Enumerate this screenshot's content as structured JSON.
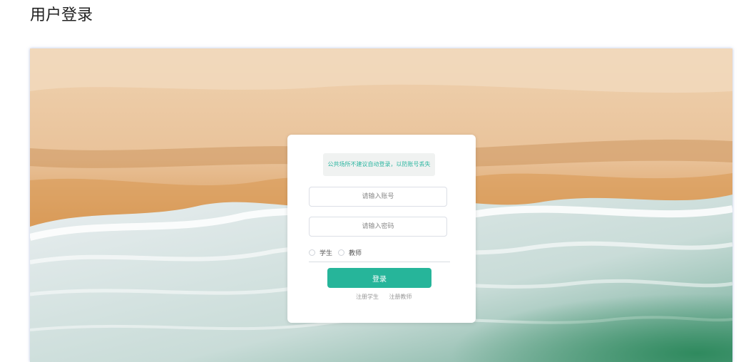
{
  "page": {
    "title": "用户登录"
  },
  "login": {
    "notice": "公共场所不建议自动登录，以防账号丢失",
    "account_placeholder": "请输入账号",
    "password_placeholder": "请输入密码",
    "roles": [
      "学生",
      "教师"
    ],
    "submit_label": "登录",
    "links": [
      "注册学生",
      "注册教师"
    ]
  },
  "colors": {
    "accent": "#26b59a",
    "notice_text": "#2bb5a0"
  }
}
